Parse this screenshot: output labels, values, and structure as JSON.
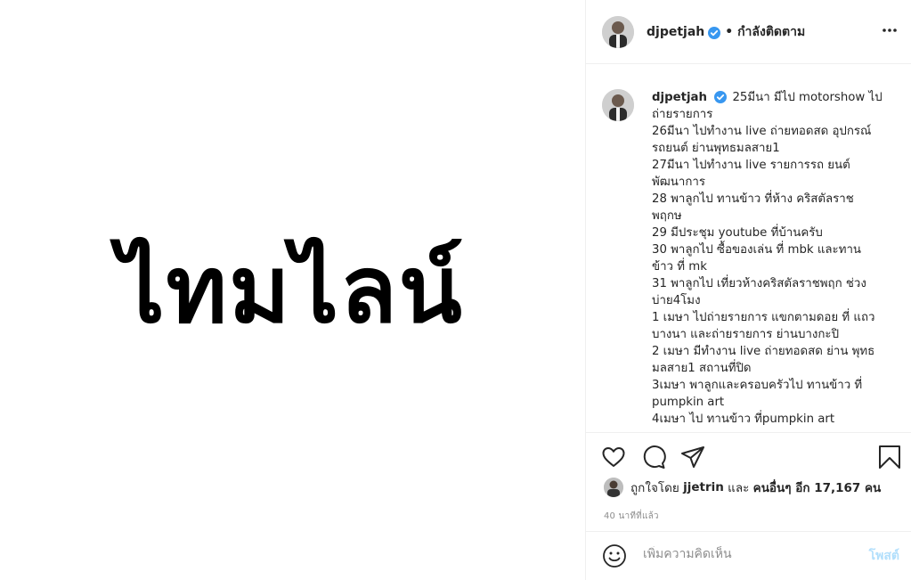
{
  "media": {
    "text": "ไทมไลน์"
  },
  "header": {
    "username": "djpetjah",
    "follow_status": "• กำลังติดตาม",
    "more_icon": "more-options-icon"
  },
  "caption": {
    "username": "djpetjah",
    "lines": [
      "25มีนา มีไป motorshow ไป ถ่ายรายการ",
      "26มีนา ไปทำงาน live ถ่ายทอดสด อุปกรณ์ รถยนต์ ย่านพุทธมลสาย1",
      "27มีนา ไปทำงาน live รายการรถ ยนต์ พัฒนาการ",
      "28 พาลูกไป ทานข้าว ที่ห้าง คริสตัลราช พฤกษ",
      "29 มีประชุม youtube ที่บ้านครับ",
      "30 พาลูกไป ซื้อของเล่น ที่ mbk และทาน ข้าว ที่ mk",
      "31 พาลูกไป เที่ยวห้างคริสตัลราชพฤก ช่วง บ่าย4โมง",
      "1 เมษา ไปถ่ายรายการ แขกตามดอย ที่ แถว บางนา และถ่ายรายการ ย่านบางกะปิ",
      "2 เมษา มีทำงาน live ถ่ายทอดสด ย่าน พุทธมลสาย1 สถานที่ปิด",
      "3เมษา พาลูกและครอบครัวไป ทานข้าว ที่ pumpkin art",
      "4เมษา ไป ทานข้าว ที่pumpkin art"
    ]
  },
  "likes": {
    "prefix": "ถูกใจโดย",
    "user": "jjetrin",
    "conj": "และ",
    "others": "คนอื่นๆ อีก 17,167 คน"
  },
  "timestamp": "40 นาทีที่แล้ว",
  "comment": {
    "placeholder": "เพิ่มความคิดเห็น",
    "post_label": "โพสต์"
  },
  "colors": {
    "verified": "#3897f0",
    "post_disabled": "#b2dffc",
    "secondary_text": "#8e8e8e"
  }
}
